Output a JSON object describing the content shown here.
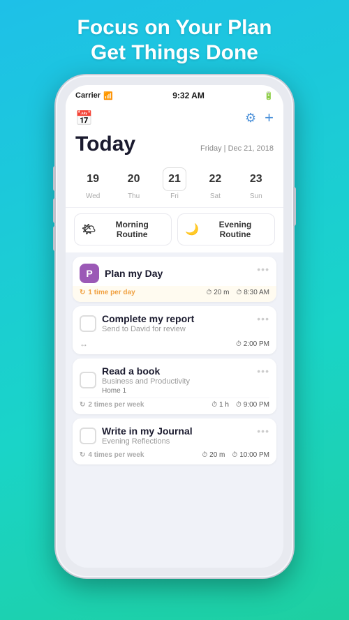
{
  "hero": {
    "line1": "Focus on Your Plan",
    "line2": "Get Things Done"
  },
  "status_bar": {
    "carrier": "Carrier",
    "time": "9:32 AM",
    "battery": "■■■"
  },
  "header": {
    "title": "Today",
    "date": "Friday | Dec 21, 2018"
  },
  "calendar": {
    "days": [
      {
        "num": "19",
        "label": "Wed",
        "active": false
      },
      {
        "num": "20",
        "label": "Thu",
        "active": false
      },
      {
        "num": "21",
        "label": "Fri",
        "active": true
      },
      {
        "num": "22",
        "label": "Sat",
        "active": false
      },
      {
        "num": "23",
        "label": "Sun",
        "active": false
      }
    ]
  },
  "routines": {
    "morning": "Morning Routine",
    "evening": "Evening Routine"
  },
  "tasks": [
    {
      "id": "plan-day",
      "icon_type": "box",
      "icon_label": "P",
      "icon_color": "purple",
      "title": "Plan my Day",
      "subtitle": "",
      "tag": "",
      "meta_style": "highlight",
      "meta_left": "1 time per day",
      "meta_duration": "20 m",
      "meta_time": "8:30 AM"
    },
    {
      "id": "complete-report",
      "icon_type": "checkbox",
      "title": "Complete my report",
      "subtitle": "Send to David for review",
      "tag": "",
      "meta_style": "normal",
      "meta_left": "",
      "meta_duration": "",
      "meta_time": "2:00 PM"
    },
    {
      "id": "read-book",
      "icon_type": "checkbox",
      "title": "Read a book",
      "subtitle": "Business and Productivity",
      "tag": "Home 1",
      "meta_style": "normal",
      "meta_left": "2 times per week",
      "meta_duration": "1 h",
      "meta_time": "9:00 PM"
    },
    {
      "id": "journal",
      "icon_type": "checkbox",
      "title": "Write in my Journal",
      "subtitle": "Evening Reflections",
      "tag": "",
      "meta_style": "normal",
      "meta_left": "4 times per week",
      "meta_duration": "20 m",
      "meta_time": "10:00 PM"
    }
  ],
  "icons": {
    "calendar": "📅",
    "filter": "⚙",
    "add": "+",
    "wifi": "📶",
    "morning": "🌤",
    "evening": "🌙",
    "repeat": "↻",
    "clock": "⏱",
    "more": "•••",
    "arrow": "↔"
  }
}
